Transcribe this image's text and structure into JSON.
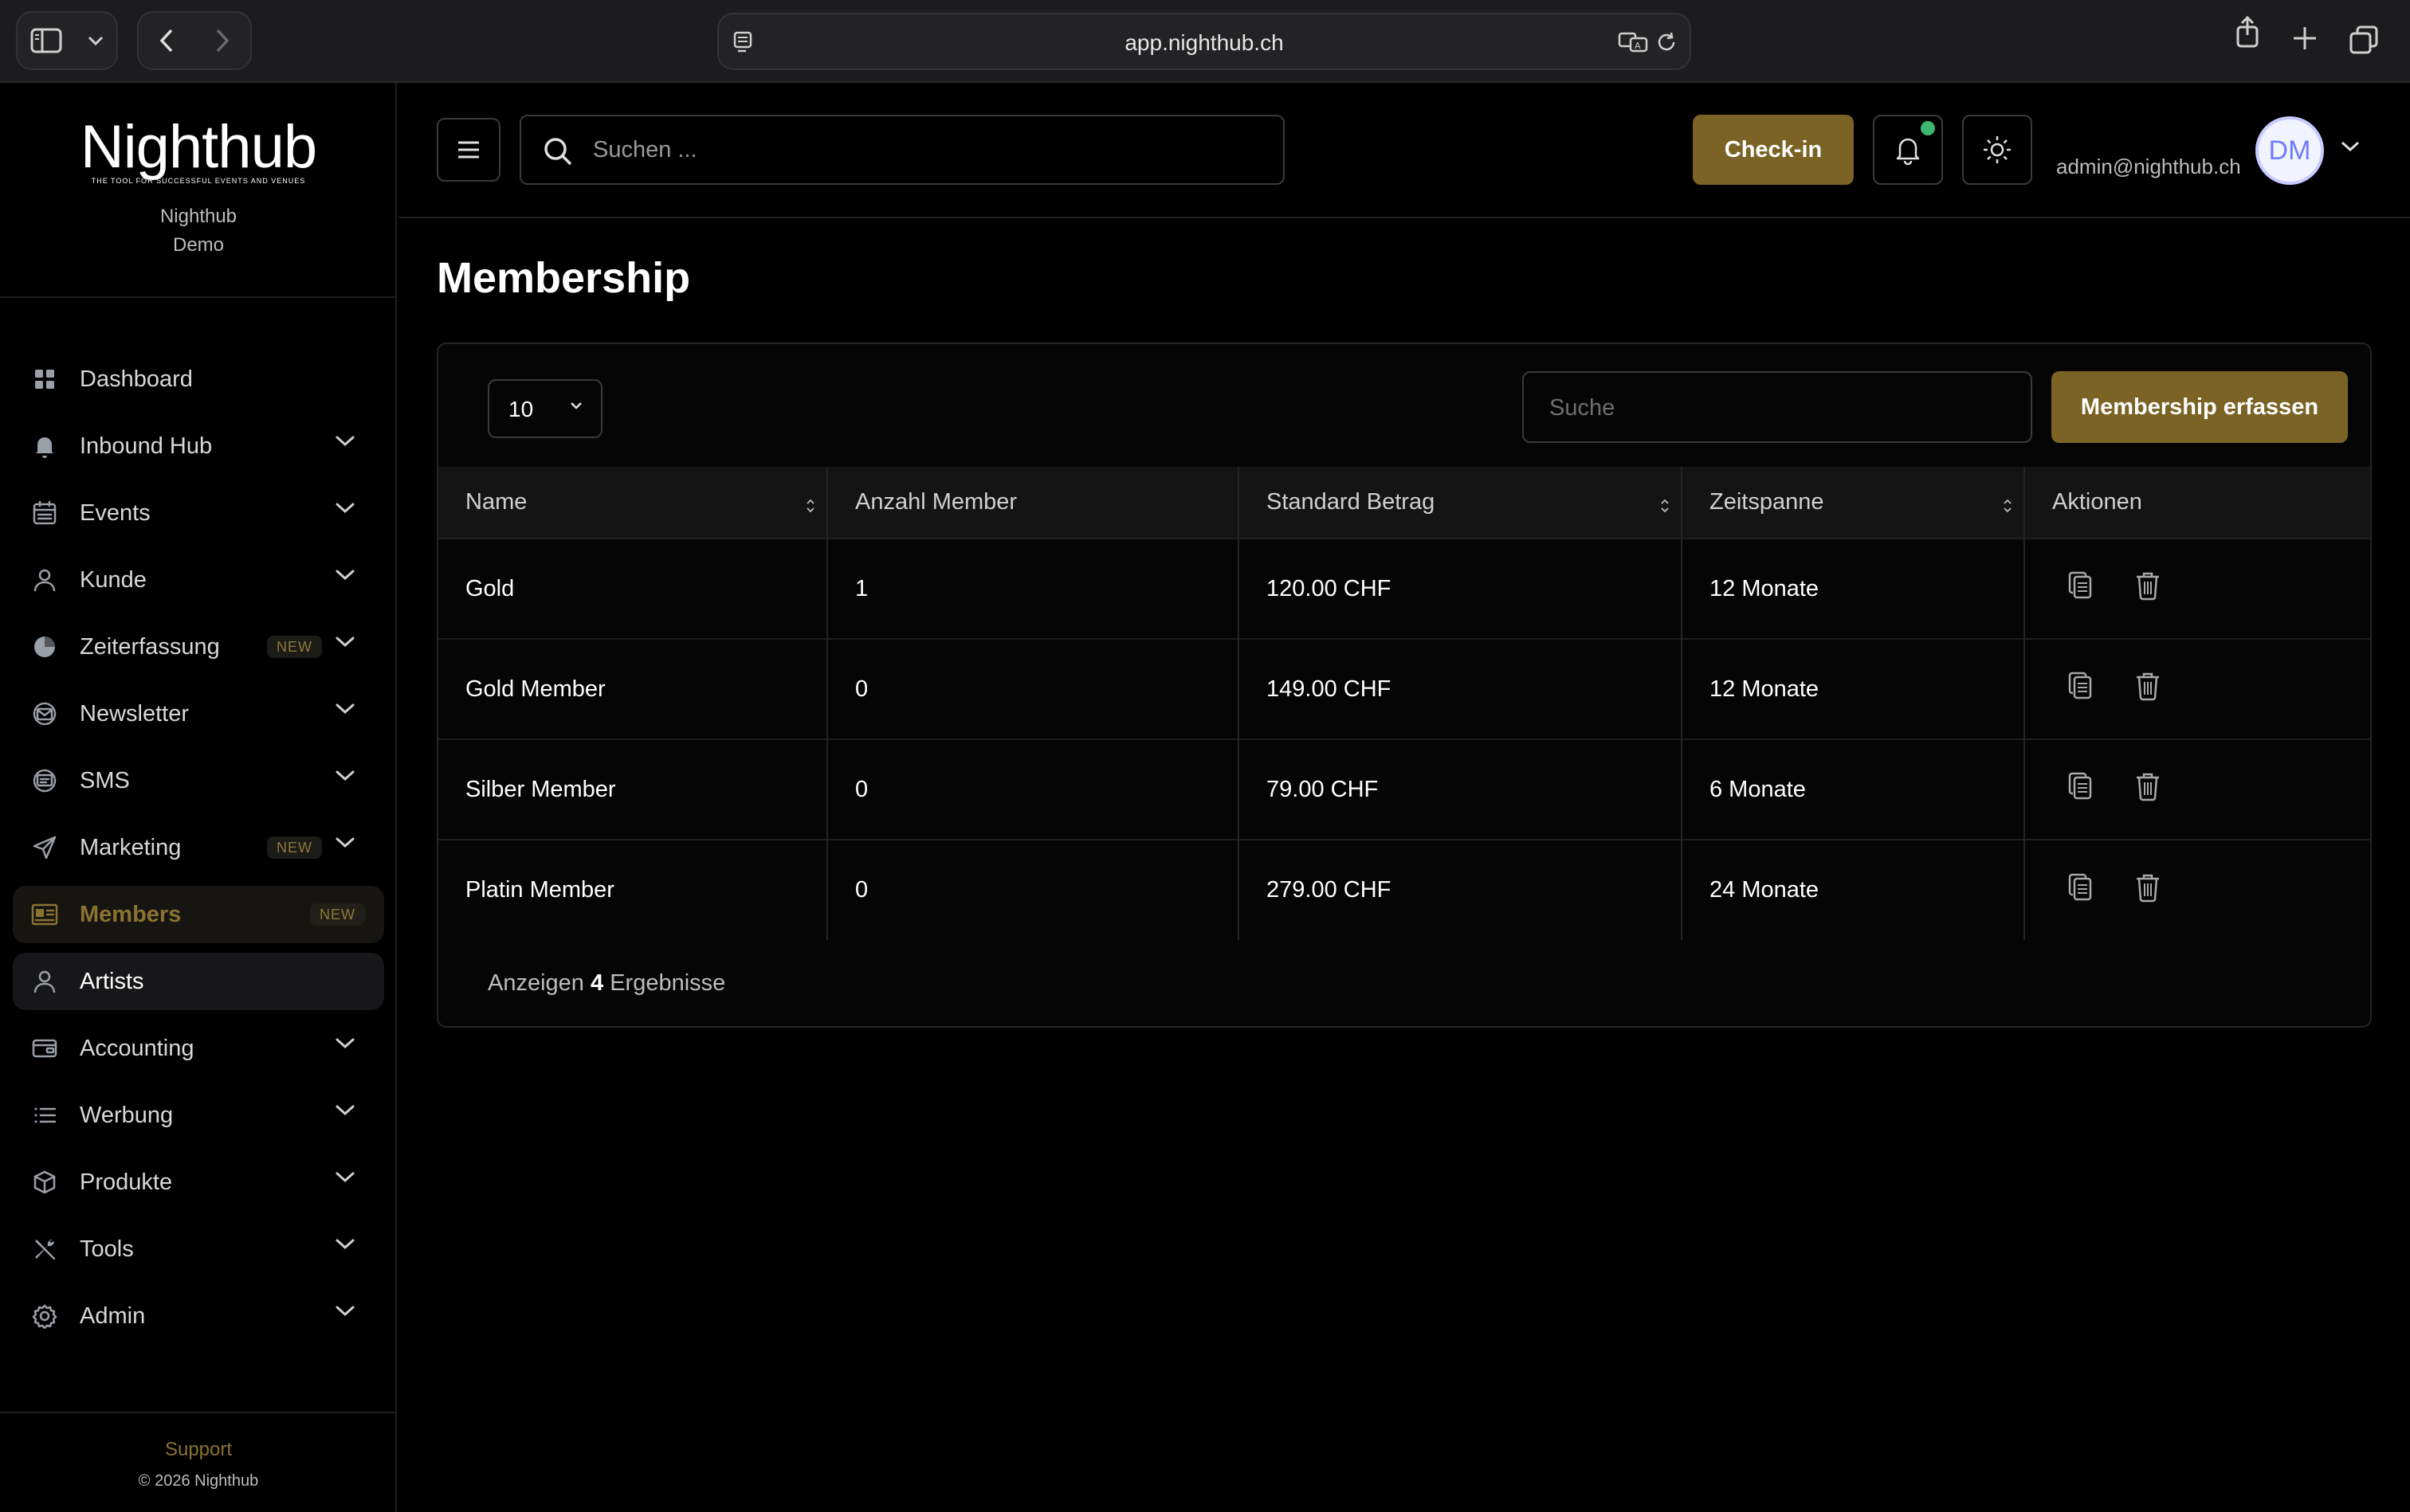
{
  "browser": {
    "url": "app.nighthub.ch"
  },
  "sidebar": {
    "logo": "Nighthub",
    "tagline": "THE TOOL FOR SUCCESSFUL EVENTS AND VENUES",
    "org_name": "Nighthub",
    "org_sub": "Demo",
    "items": [
      {
        "label": "Dashboard",
        "icon": "grid-icon",
        "chevron": false
      },
      {
        "label": "Inbound Hub",
        "icon": "bell-icon",
        "chevron": true
      },
      {
        "label": "Events",
        "icon": "calendar-icon",
        "chevron": true
      },
      {
        "label": "Kunde",
        "icon": "user-icon",
        "chevron": true
      },
      {
        "label": "Zeiterfassung",
        "icon": "clock-icon",
        "chevron": true,
        "badge": "NEW"
      },
      {
        "label": "Newsletter",
        "icon": "mail-icon",
        "chevron": true
      },
      {
        "label": "SMS",
        "icon": "sms-icon",
        "chevron": true
      },
      {
        "label": "Marketing",
        "icon": "send-icon",
        "chevron": true,
        "badge": "NEW"
      },
      {
        "label": "Members",
        "icon": "id-card-icon",
        "chevron": false,
        "badge": "NEW",
        "active": true
      },
      {
        "label": "Artists",
        "icon": "user-icon",
        "chevron": false,
        "hover": true
      },
      {
        "label": "Accounting",
        "icon": "wallet-icon",
        "chevron": true
      },
      {
        "label": "Werbung",
        "icon": "list-icon",
        "chevron": true
      },
      {
        "label": "Produkte",
        "icon": "box-icon",
        "chevron": true
      },
      {
        "label": "Tools",
        "icon": "tools-icon",
        "chevron": true
      },
      {
        "label": "Admin",
        "icon": "gear-icon",
        "chevron": true
      }
    ],
    "support": "Support",
    "copyright": "© 2026 Nighthub"
  },
  "header": {
    "search_placeholder": "Suchen ...",
    "checkin_label": "Check-in",
    "user_email": "admin@nighthub.ch",
    "avatar_initials": "DM"
  },
  "main": {
    "title": "Membership",
    "per_page": "10",
    "search_placeholder": "Suche",
    "add_button": "Membership erfassen",
    "columns": [
      "Name",
      "Anzahl Member",
      "Standard Betrag",
      "Zeitspanne",
      "Aktionen"
    ],
    "rows": [
      {
        "name": "Gold",
        "count": "1",
        "amount": "120.00 CHF",
        "period": "12 Monate"
      },
      {
        "name": "Gold Member",
        "count": "0",
        "amount": "149.00 CHF",
        "period": "12 Monate"
      },
      {
        "name": "Silber Member",
        "count": "0",
        "amount": "79.00 CHF",
        "period": "6 Monate"
      },
      {
        "name": "Platin Member",
        "count": "0",
        "amount": "279.00 CHF",
        "period": "24 Monate"
      }
    ],
    "footer": {
      "prefix": "Anzeigen",
      "count": "4",
      "suffix": "Ergebnisse"
    }
  },
  "colors": {
    "accent": "#7a6324",
    "accent_text": "#8a7330",
    "notification_dot": "#3bb56f"
  }
}
